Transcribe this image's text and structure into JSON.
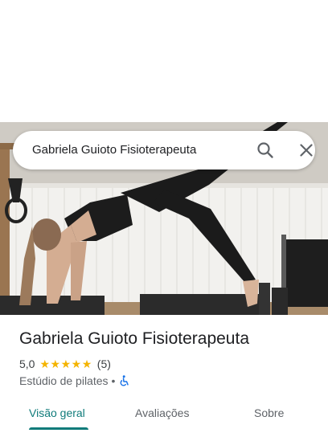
{
  "search": {
    "query": "Gabriela Guioto Fisioterapeuta",
    "search_icon": "search-icon",
    "close_icon": "close-icon"
  },
  "photo": {
    "description_icon": "place-photo"
  },
  "place": {
    "title": "Gabriela Guioto Fisioterapeuta",
    "rating": "5,0",
    "stars": "★★★★★",
    "review_count": "(5)",
    "category": "Estúdio de pilates",
    "separator": "•",
    "accessibility_icon": "wheelchair-icon"
  },
  "tabs": [
    {
      "label": "Visão geral",
      "active": true
    },
    {
      "label": "Avaliações",
      "active": false
    },
    {
      "label": "Sobre",
      "active": false
    }
  ],
  "colors": {
    "accent": "#0f7b7a",
    "star": "#f4b400",
    "accessibility": "#1a73e8"
  }
}
